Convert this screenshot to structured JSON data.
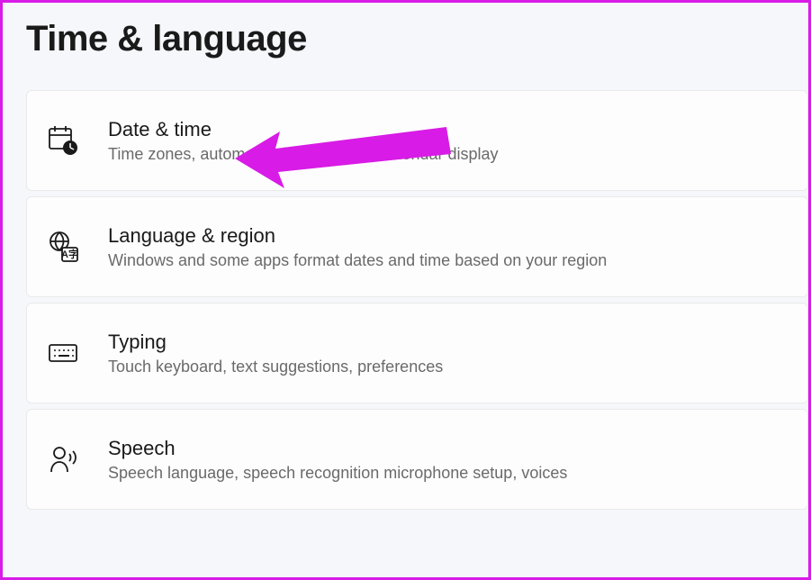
{
  "header": {
    "title": "Time & language"
  },
  "items": [
    {
      "icon": "calendar-clock-icon",
      "title": "Date & time",
      "subtitle": "Time zones, automatic clock settings, calendar display"
    },
    {
      "icon": "globe-translate-icon",
      "title": "Language & region",
      "subtitle": "Windows and some apps format dates and time based on your region"
    },
    {
      "icon": "keyboard-icon",
      "title": "Typing",
      "subtitle": "Touch keyboard, text suggestions, preferences"
    },
    {
      "icon": "speech-icon",
      "title": "Speech",
      "subtitle": "Speech language, speech recognition microphone setup, voices"
    }
  ],
  "annotation": {
    "color": "#d81be6"
  }
}
